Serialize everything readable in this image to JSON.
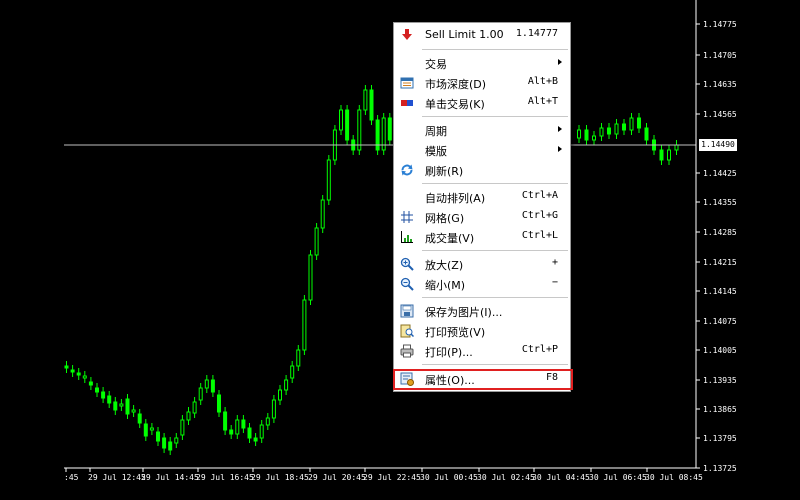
{
  "chart": {
    "price_axis": [
      "1.14775",
      "1.14705",
      "1.14635",
      "1.14565",
      "1.14425",
      "1.14355",
      "1.14285",
      "1.14215",
      "1.14145",
      "1.14075",
      "1.14005",
      "1.13935",
      "1.13865",
      "1.13795",
      "1.13725"
    ],
    "current_price": "1.14490",
    "time_axis": [
      ":45",
      "29 Jul 12:45",
      "29 Jul 14:45",
      "29 Jul 16:45",
      "29 Jul 18:45",
      "29 Jul 20:45",
      "29 Jul 22:45",
      "30 Jul 00:45",
      "30 Jul 02:45",
      "30 Jul 04:45",
      "30 Jul 06:45",
      "30 Jul 08:45"
    ],
    "bull_color": "#00ff00",
    "line_color": "#c0c0c0"
  },
  "menu": {
    "items": [
      {
        "id": "sell-limit",
        "label": "Sell Limit 1.00",
        "shortcut": "1.14777",
        "icon": "sell-limit-icon"
      },
      {
        "id": "trade",
        "label": "交易",
        "submenu": true
      },
      {
        "id": "market-depth",
        "label": "市场深度(D)",
        "shortcut": "Alt+B",
        "icon": "market-depth-icon"
      },
      {
        "id": "one-click-trading",
        "label": "单击交易(K)",
        "shortcut": "Alt+T",
        "icon": "one-click-trading-icon"
      },
      {
        "id": "timeframes",
        "label": "周期",
        "submenu": true
      },
      {
        "id": "templates",
        "label": "模版",
        "submenu": true
      },
      {
        "id": "refresh",
        "label": "刷新(R)",
        "icon": "refresh-icon"
      },
      {
        "id": "auto-arrange",
        "label": "自动排列(A)",
        "shortcut": "Ctrl+A"
      },
      {
        "id": "grid",
        "label": "网格(G)",
        "shortcut": "Ctrl+G",
        "icon": "grid-icon"
      },
      {
        "id": "volumes",
        "label": "成交量(V)",
        "shortcut": "Ctrl+L",
        "icon": "volumes-icon"
      },
      {
        "id": "zoom-in",
        "label": "放大(Z)",
        "shortcut": "+",
        "icon": "zoom-in-icon"
      },
      {
        "id": "zoom-out",
        "label": "缩小(M)",
        "shortcut": "−",
        "icon": "zoom-out-icon"
      },
      {
        "id": "save-as-picture",
        "label": "保存为图片(I)...",
        "icon": "save-picture-icon"
      },
      {
        "id": "print-preview",
        "label": "打印预览(V)",
        "icon": "print-preview-icon"
      },
      {
        "id": "print",
        "label": "打印(P)...",
        "shortcut": "Ctrl+P",
        "icon": "printer-icon"
      },
      {
        "id": "properties",
        "label": "属性(O)...",
        "shortcut": "F8",
        "icon": "properties-icon"
      }
    ]
  }
}
